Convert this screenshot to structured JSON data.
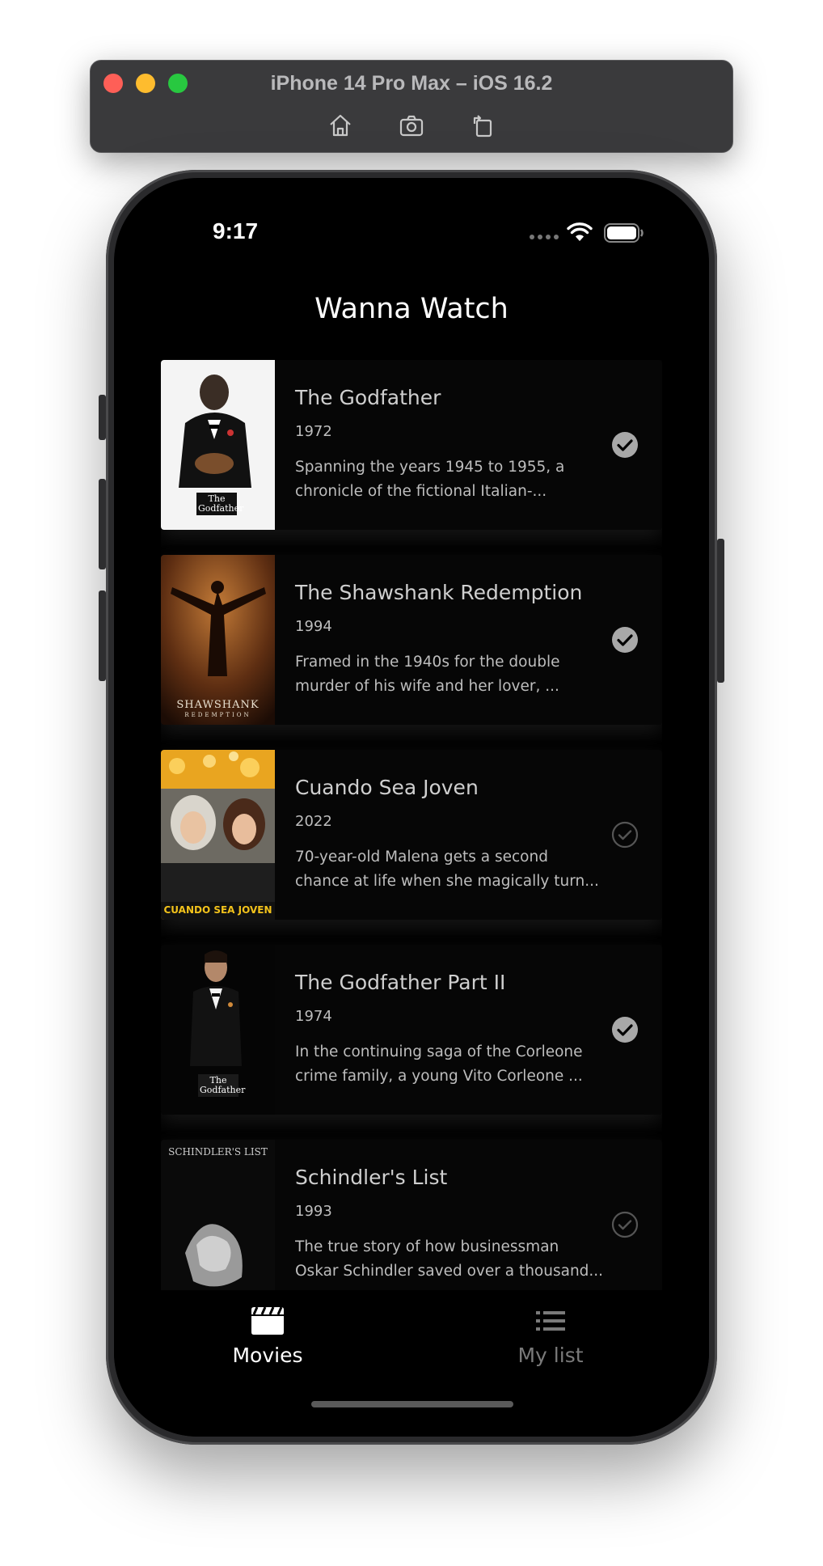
{
  "simulator": {
    "title": "iPhone 14 Pro Max – iOS 16.2",
    "tools": [
      {
        "icon": "home-icon"
      },
      {
        "icon": "screenshot-icon"
      },
      {
        "icon": "rotate-icon"
      }
    ]
  },
  "status_bar": {
    "time": "9:17"
  },
  "app": {
    "title": "Wanna Watch"
  },
  "movies": [
    {
      "title": "The Godfather",
      "year": "1972",
      "desc_line1": "Spanning the years 1945 to 1955, a",
      "desc_line2": "chronicle of the fictional Italian-...",
      "watched": true,
      "poster_caption": "The Godfather"
    },
    {
      "title": "The Shawshank Redemption",
      "year": "1994",
      "desc_line1": "Framed in the 1940s for the double",
      "desc_line2": "murder of his wife and her lover, ...",
      "watched": true,
      "poster_caption": "SHAWSHANK",
      "poster_subcaption": "REDEMPTION"
    },
    {
      "title": "Cuando Sea Joven",
      "year": "2022",
      "desc_line1": "70-year-old Malena gets a second",
      "desc_line2": "chance at life when she magically turn...",
      "watched": false,
      "poster_caption": "CUANDO SEA JOVEN"
    },
    {
      "title": "The Godfather Part II",
      "year": "1974",
      "desc_line1": "In the continuing saga of the Corleone",
      "desc_line2": "crime family, a young Vito Corleone ...",
      "watched": true,
      "poster_caption": "The Godfather"
    },
    {
      "title": "Schindler's List",
      "year": "1993",
      "desc_line1": "The true story of how businessman",
      "desc_line2": "Oskar Schindler saved over a thousand...",
      "watched": false,
      "poster_caption": "SCHINDLER'S LIST"
    }
  ],
  "tabbar": {
    "movies_label": "Movies",
    "mylist_label": "My list",
    "active": "Movies"
  },
  "colors": {
    "background": "#000000",
    "checked": "#a8a8a8",
    "unchecked": "#555555",
    "active_tab": "#ffffff",
    "inactive_tab": "#7a7a7a"
  }
}
